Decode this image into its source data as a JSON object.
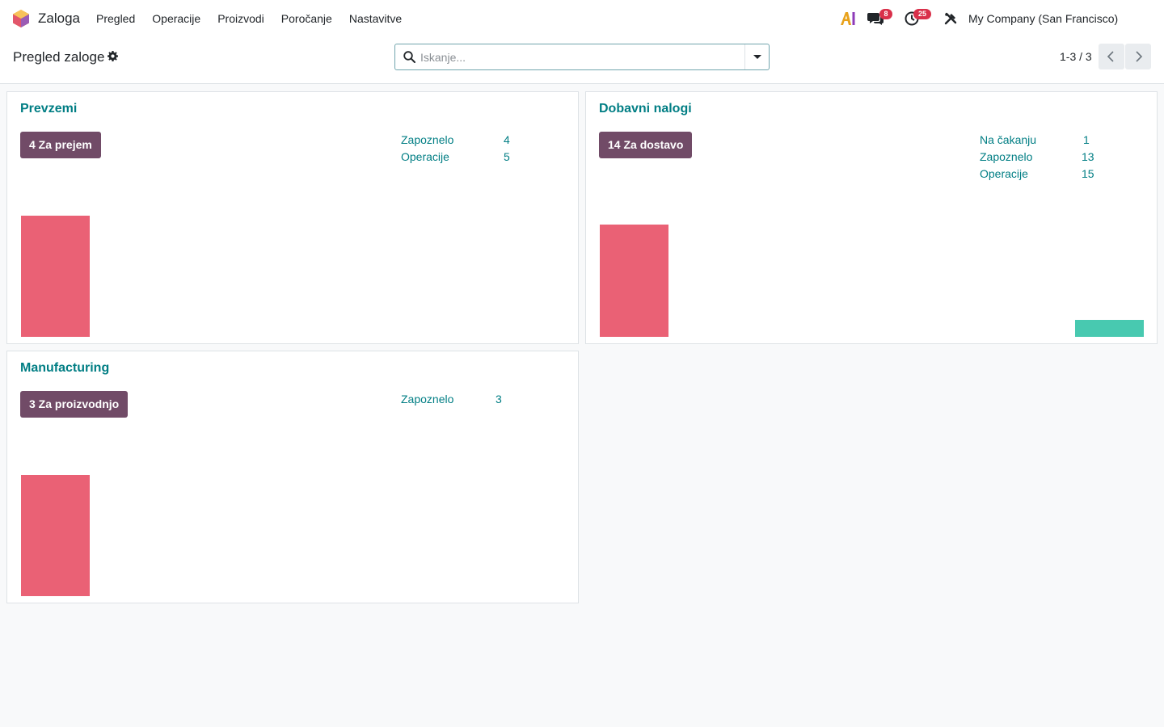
{
  "navbar": {
    "app_name": "Zaloga",
    "menu": [
      "Pregled",
      "Operacije",
      "Proizvodi",
      "Poročanje",
      "Nastavitve"
    ],
    "chat_badge": "8",
    "activity_badge": "25",
    "company": "My Company (San Francisco)",
    "icons": [
      "app-logo-icon",
      "ai-icon",
      "chat-icon",
      "activity-clock-icon",
      "tools-icon"
    ]
  },
  "control_panel": {
    "title": "Pregled zaloge",
    "search_placeholder": "Iskanje...",
    "pager": "1-3 / 3"
  },
  "colors": {
    "brand": "#714b67",
    "link": "#017e84",
    "bar_late": "#ea6175",
    "bar_future": "#48c9b0"
  },
  "cards": [
    {
      "title": "Prevzemi",
      "button": "4 Za prejem",
      "stats": [
        {
          "label": "Zapoznelo",
          "value": "4"
        },
        {
          "label": "Operacije",
          "value": "5"
        }
      ],
      "graph": {
        "bars": [
          {
            "value": 1,
            "color": "late"
          }
        ]
      }
    },
    {
      "title": "Dobavni nalogi",
      "button": "14 Za dostavo",
      "stats": [
        {
          "label": "Na čakanju",
          "value": "1"
        },
        {
          "label": "Zapoznelo",
          "value": "13"
        },
        {
          "label": "Operacije",
          "value": "15"
        }
      ],
      "graph": {
        "bars": [
          {
            "value": 13,
            "color": "late"
          },
          {
            "value": 2,
            "color": "future"
          }
        ]
      }
    },
    {
      "title": "Manufacturing",
      "button": "3 Za proizvodnjo",
      "stats": [
        {
          "label": "Zapoznelo",
          "value": "3"
        }
      ],
      "graph": {
        "bars": [
          {
            "value": 1,
            "color": "late"
          }
        ]
      }
    }
  ]
}
